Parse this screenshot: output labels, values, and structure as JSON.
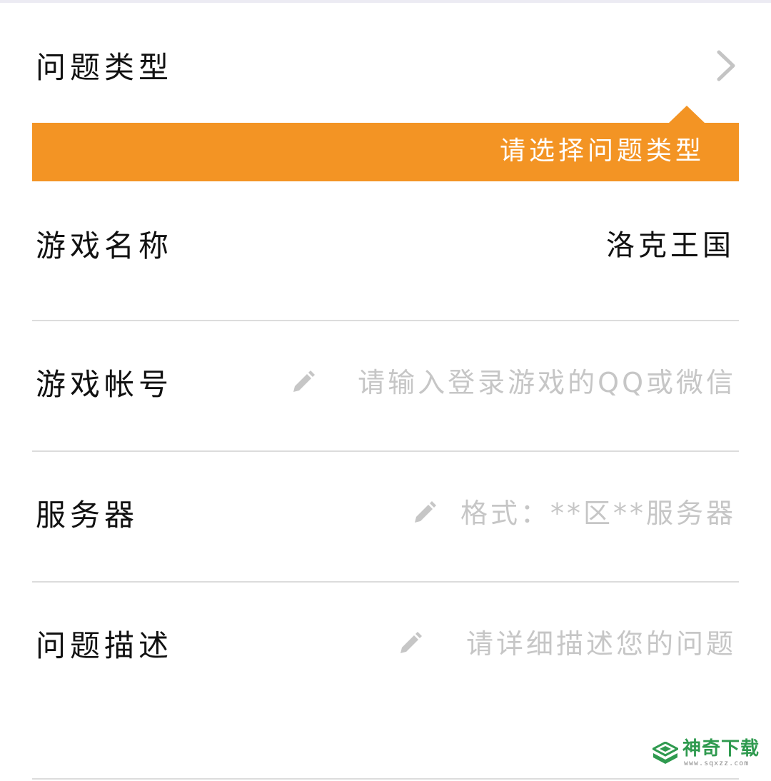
{
  "form": {
    "problem_type": {
      "label": "问题类型",
      "icon": "chevron-right-icon",
      "tooltip": "请选择问题类型"
    },
    "game_name": {
      "label": "游戏名称",
      "value": "洛克王国"
    },
    "game_account": {
      "label": "游戏帐号",
      "placeholder": "请输入登录游戏的QQ或微信",
      "value": ""
    },
    "server": {
      "label": "服务器",
      "placeholder": "格式：**区**服务器",
      "value": ""
    },
    "description": {
      "label": "问题描述",
      "placeholder": "请详细描述您的问题",
      "value": ""
    }
  },
  "watermark": {
    "name": "神奇下载",
    "url": "www.sqxzz.com"
  },
  "colors": {
    "accent": "#f39424",
    "placeholder": "#c6c6c6",
    "text": "#111111",
    "divider": "#dcdcdc",
    "watermark": "#2f9a4f"
  }
}
